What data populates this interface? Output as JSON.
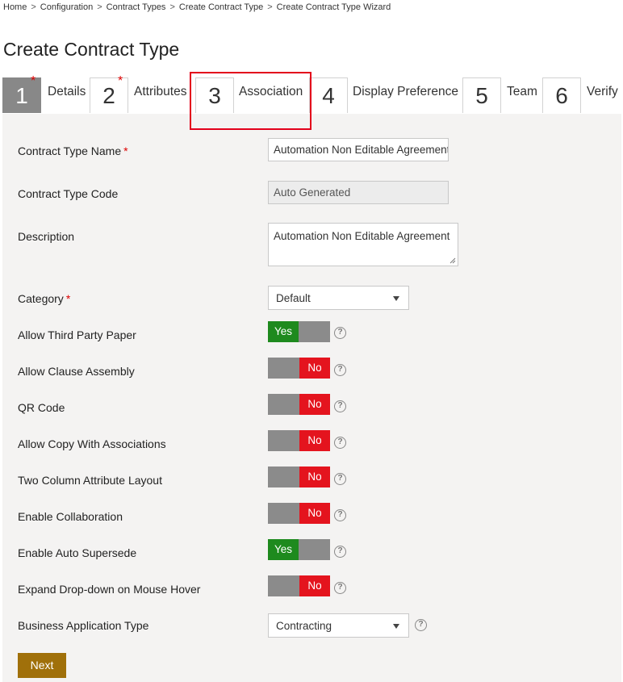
{
  "breadcrumb": [
    "Home",
    "Configuration",
    "Contract Types",
    "Create Contract Type",
    "Create Contract Type Wizard"
  ],
  "page_title": "Create Contract Type",
  "steps": [
    {
      "num": "1",
      "label": "Details",
      "required": "*"
    },
    {
      "num": "2",
      "label": "Attributes",
      "required": "*"
    },
    {
      "num": "3",
      "label": "Association",
      "required": ""
    },
    {
      "num": "4",
      "label": "Display Preference",
      "required": ""
    },
    {
      "num": "5",
      "label": "Team",
      "required": ""
    },
    {
      "num": "6",
      "label": "Verify",
      "required": ""
    }
  ],
  "form": {
    "contract_type_name": {
      "label": "Contract Type Name",
      "required": "*",
      "value": "Automation Non Editable Agreement"
    },
    "contract_type_code": {
      "label": "Contract Type Code",
      "value": "Auto Generated"
    },
    "description": {
      "label": "Description",
      "value": "Automation Non Editable Agreement"
    },
    "category": {
      "label": "Category",
      "required": "*",
      "value": "Default"
    },
    "toggles": [
      {
        "label": "Allow Third Party Paper",
        "state": "Yes"
      },
      {
        "label": "Allow Clause Assembly",
        "state": "No"
      },
      {
        "label": "QR Code",
        "state": "No"
      },
      {
        "label": "Allow Copy With Associations",
        "state": "No"
      },
      {
        "label": "Two Column Attribute Layout",
        "state": "No"
      },
      {
        "label": "Enable Collaboration",
        "state": "No"
      },
      {
        "label": "Enable Auto Supersede",
        "state": "Yes"
      },
      {
        "label": "Expand Drop-down on Mouse Hover",
        "state": "No"
      }
    ],
    "business_application_type": {
      "label": "Business Application Type",
      "value": "Contracting"
    },
    "help_icon": "?"
  },
  "next_label": "Next",
  "colors": {
    "yes": "#1e8a1e",
    "no": "#e4141e",
    "active_step": "#888888",
    "next_button": "#a0700a",
    "highlight": "#e3001b"
  }
}
